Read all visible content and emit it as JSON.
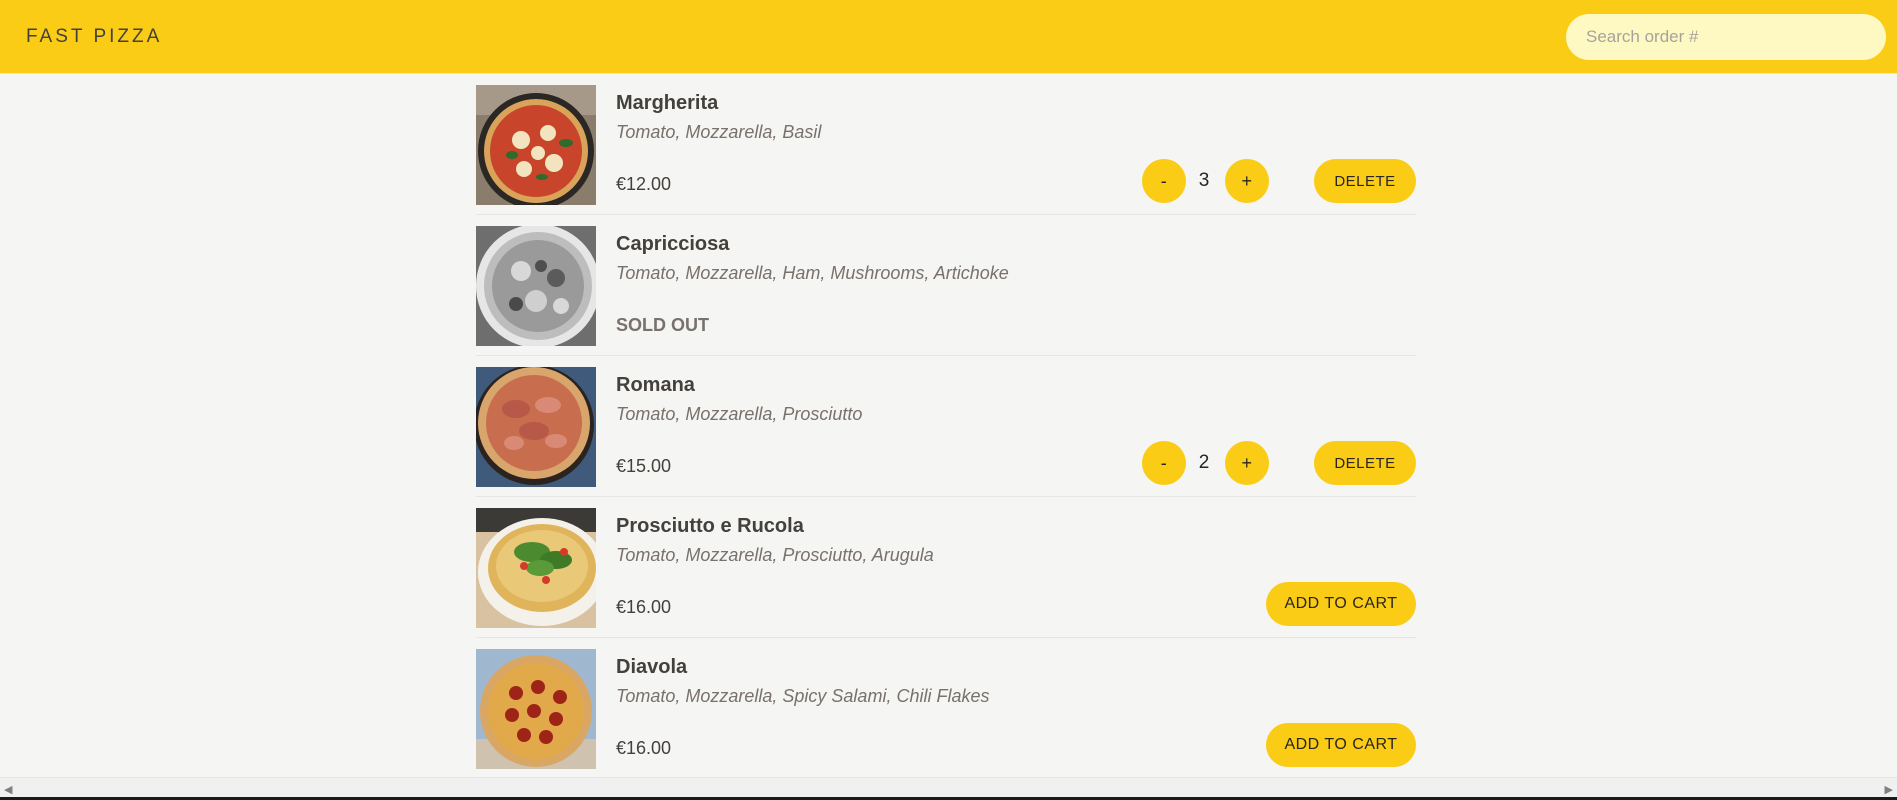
{
  "header": {
    "logo": "Fast Pizza",
    "search_placeholder": "Search order #"
  },
  "menu": {
    "items": [
      {
        "name": "Margherita",
        "ingredients": "Tomato, Mozzarella, Basil",
        "price": "€12.00",
        "sold_out": false,
        "in_cart": true,
        "quantity": "3",
        "minus_label": "-",
        "plus_label": "+",
        "delete_label": "Delete",
        "image": "margherita-pizza-photo"
      },
      {
        "name": "Capricciosa",
        "ingredients": "Tomato, Mozzarella, Ham, Mushrooms, Artichoke",
        "status": "Sold out",
        "sold_out": true,
        "image": "capricciosa-pizza-photo-grayscale"
      },
      {
        "name": "Romana",
        "ingredients": "Tomato, Mozzarella, Prosciutto",
        "price": "€15.00",
        "sold_out": false,
        "in_cart": true,
        "quantity": "2",
        "minus_label": "-",
        "plus_label": "+",
        "delete_label": "Delete",
        "image": "romana-pizza-photo"
      },
      {
        "name": "Prosciutto e Rucola",
        "ingredients": "Tomato, Mozzarella, Prosciutto, Arugula",
        "price": "€16.00",
        "sold_out": false,
        "in_cart": false,
        "add_label": "Add to cart",
        "image": "prosciutto-rucola-pizza-photo"
      },
      {
        "name": "Diavola",
        "ingredients": "Tomato, Mozzarella, Spicy Salami, Chili Flakes",
        "price": "€16.00",
        "sold_out": false,
        "in_cart": false,
        "add_label": "Add to cart",
        "image": "diavola-pizza-photo"
      }
    ]
  },
  "scrollbar": {
    "left_arrow": "◀",
    "right_arrow": "▶"
  },
  "colors": {
    "accent": "#facc15",
    "background": "#f5f5f4",
    "search_bg": "#fef9c3",
    "text": "#44403c",
    "muted": "#78716c"
  }
}
